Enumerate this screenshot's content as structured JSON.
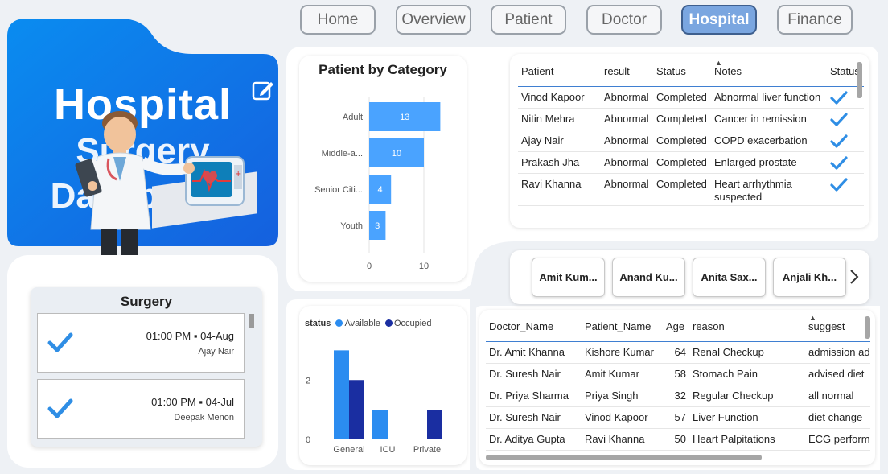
{
  "nav": {
    "items": [
      {
        "label": "Home",
        "active": false
      },
      {
        "label": "Overview",
        "active": false
      },
      {
        "label": "Patient",
        "active": false
      },
      {
        "label": "Doctor",
        "active": false
      },
      {
        "label": "Hospital",
        "active": true
      },
      {
        "label": "Finance",
        "active": false
      }
    ]
  },
  "hero": {
    "title": "Hospital",
    "subtitle_line1": "Surgery",
    "subtitle_line2": "Dashboard",
    "gradient_start": "#0a8cf0",
    "gradient_end": "#1560de",
    "icons": [
      "edit-icon",
      "doctor-illustration",
      "monitor-illustration"
    ]
  },
  "surgery": {
    "title": "Surgery",
    "items": [
      {
        "time": "01:00 PM ▪ 04-Aug",
        "name": "Ajay Nair",
        "icon": "check-icon"
      },
      {
        "time": "01:00 PM ▪ 04-Jul",
        "name": "Deepak Menon",
        "icon": "check-icon"
      }
    ]
  },
  "patient_table": {
    "columns": [
      "Patient",
      "result",
      "Status",
      "Notes",
      "Status"
    ],
    "rows": [
      [
        "Vinod Kapoor",
        "Abnormal",
        "Completed",
        "Abnormal liver function"
      ],
      [
        "Nitin Mehra",
        "Abnormal",
        "Completed",
        "Cancer in remission"
      ],
      [
        "Ajay Nair",
        "Abnormal",
        "Completed",
        "COPD exacerbation"
      ],
      [
        "Prakash Jha",
        "Abnormal",
        "Completed",
        "Enlarged prostate"
      ],
      [
        "Ravi Khanna",
        "Abnormal",
        "Completed",
        "Heart arrhythmia suspected"
      ]
    ],
    "status_icon": "check-icon",
    "sort_column": "Notes"
  },
  "doctor_slicer": {
    "items": [
      "Amit Kum...",
      "Anand Ku...",
      "Anita Sax...",
      "Anjali Kh..."
    ],
    "next_icon": "chevron-right-icon"
  },
  "doctor_table": {
    "columns": [
      "Doctor_Name",
      "Patient_Name",
      "Age",
      "reason",
      "suggest"
    ],
    "rows": [
      [
        "Dr. Amit Khanna",
        "Kishore Kumar",
        "64",
        "Renal Checkup",
        "admission ad"
      ],
      [
        "Dr. Suresh Nair",
        "Amit Kumar",
        "58",
        "Stomach Pain",
        "advised diet"
      ],
      [
        "Dr. Priya Sharma",
        "Priya Singh",
        "32",
        "Regular Checkup",
        "all normal"
      ],
      [
        "Dr. Suresh Nair",
        "Vinod Kapoor",
        "57",
        "Liver Function",
        "diet change"
      ],
      [
        "Dr. Aditya Gupta",
        "Ravi Khanna",
        "50",
        "Heart Palpitations",
        "ECG perform"
      ]
    ],
    "sort_column": "suggest"
  },
  "chart_data": [
    {
      "type": "bar",
      "orientation": "horizontal",
      "title": "Patient by Category",
      "categories": [
        "Adult",
        "Middle-a...",
        "Senior Citi...",
        "Youth"
      ],
      "values": [
        13,
        10,
        4,
        3
      ],
      "data_labels": [
        "13",
        "10",
        "4",
        "3"
      ],
      "xticks": [
        "0",
        "10"
      ],
      "xlim": [
        0,
        15
      ],
      "color": "#4aa3ff"
    },
    {
      "type": "bar",
      "orientation": "vertical",
      "legend_title": "status",
      "legend_position": "top-left",
      "categories": [
        "General",
        "ICU",
        "Private"
      ],
      "series": [
        {
          "name": "Available",
          "values": [
            3,
            1,
            0
          ],
          "color": "#2b8cf0"
        },
        {
          "name": "Occupied",
          "values": [
            2,
            0,
            1
          ],
          "color": "#1a2ea1"
        }
      ],
      "yticks": [
        "0",
        "2"
      ],
      "ylim": [
        0,
        3.2
      ]
    }
  ]
}
